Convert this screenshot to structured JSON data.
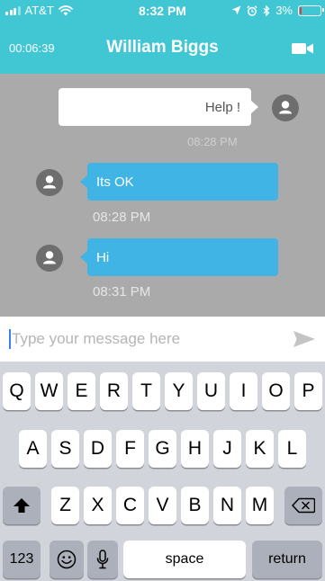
{
  "status_bar": {
    "carrier": "AT&T",
    "time": "8:32 PM",
    "battery_percent": "3%",
    "battery_level": 0.03,
    "icons": [
      "signal-icon",
      "wifi-icon",
      "location-arrow-icon",
      "alarm-icon",
      "bluetooth-icon",
      "battery-icon"
    ]
  },
  "header": {
    "call_timer": "00:06:39",
    "contact_name": "William Biggs",
    "video_icon": "video-camera-icon"
  },
  "colors": {
    "header_bg": "#40c7d3",
    "chat_bg": "#aaaaaa",
    "incoming_bubble": "#3fb4e5",
    "outgoing_bubble": "#ffffff",
    "battery_low": "#e53935"
  },
  "messages": [
    {
      "direction": "outgoing",
      "text": "Help !",
      "time": "08:28 PM"
    },
    {
      "direction": "incoming",
      "text": "Its OK",
      "time": "08:28 PM"
    },
    {
      "direction": "incoming",
      "text": "Hi",
      "time": "08:31 PM"
    }
  ],
  "input": {
    "placeholder": "Type your message here",
    "value": "",
    "send_icon": "send-icon"
  },
  "keyboard": {
    "row1": [
      "Q",
      "W",
      "E",
      "R",
      "T",
      "Y",
      "U",
      "I",
      "O",
      "P"
    ],
    "row2": [
      "A",
      "S",
      "D",
      "F",
      "G",
      "H",
      "J",
      "K",
      "L"
    ],
    "row3": [
      "Z",
      "X",
      "C",
      "V",
      "B",
      "N",
      "M"
    ],
    "numbers_label": "123",
    "space_label": "space",
    "return_label": "return"
  }
}
